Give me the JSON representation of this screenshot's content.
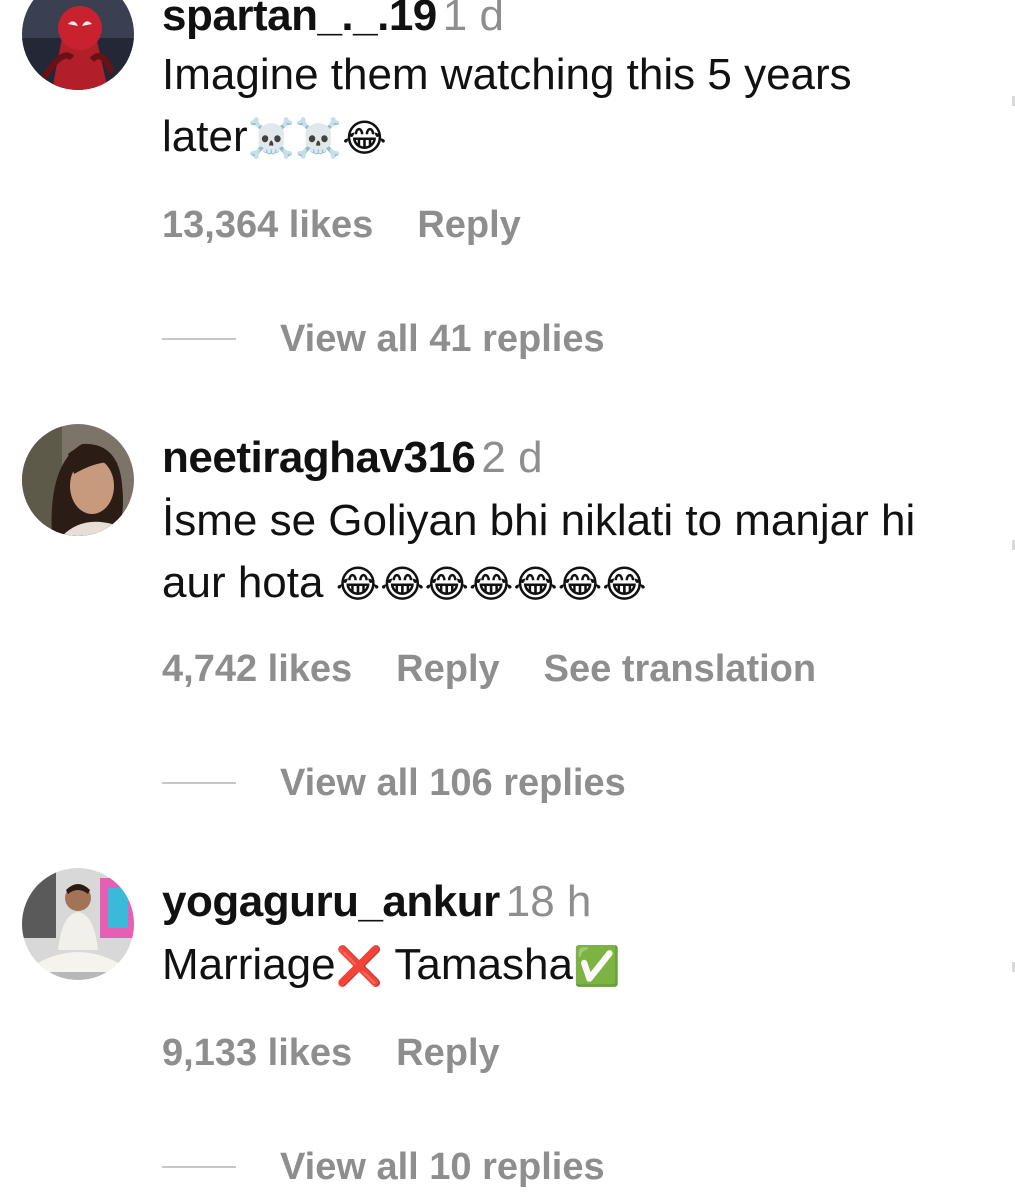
{
  "comments": [
    {
      "username": "spartan_._.19",
      "time": "1 d",
      "text": "Imagine them watching this 5 years later",
      "emojis": "☠️☠️😂",
      "likes": "13,364 likes",
      "reply_label": "Reply",
      "translation_label": "",
      "view_replies": "View all 41 replies",
      "avatar_icon": "spiderman-avatar"
    },
    {
      "username": "neetiraghav316",
      "time": "2 d",
      "text": "İsme se Goliyan bhi niklati to manjar hi aur hota",
      "emojis": "😂😂😂😂😂😂😂",
      "likes": "4,742 likes",
      "reply_label": "Reply",
      "translation_label": "See translation",
      "view_replies": "View all 106 replies",
      "avatar_icon": "woman-avatar"
    },
    {
      "username": "yogaguru_ankur",
      "time": "18 h",
      "text": "Marriage",
      "text_after": "Tamasha",
      "emoji_mid": "❌",
      "emoji_end": "✅",
      "likes": "9,133 likes",
      "reply_label": "Reply",
      "translation_label": "",
      "view_replies": "View all 10 replies",
      "avatar_icon": "yoga-man-avatar"
    }
  ],
  "colors": {
    "text": "#111111",
    "secondary": "#8e8e8e",
    "divider": "#c7c7c7",
    "cross": "#e0242b",
    "check": "#3cb54a"
  }
}
